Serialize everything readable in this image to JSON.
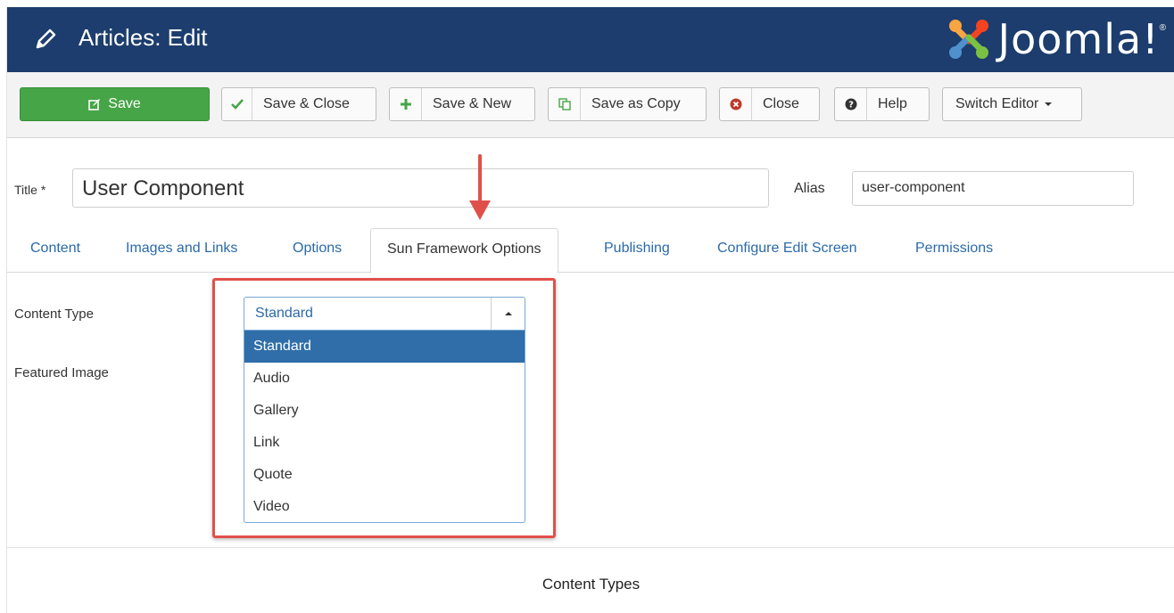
{
  "header": {
    "title": "Articles: Edit",
    "logo_text": "Joomla!",
    "logo_reg": "®",
    "bg_color": "#1c3d6d"
  },
  "toolbar": {
    "save_label": "Save",
    "save_close_label": "Save & Close",
    "save_new_label": "Save & New",
    "save_copy_label": "Save as Copy",
    "close_label": "Close",
    "help_label": "Help",
    "switch_editor_label": "Switch Editor",
    "save_color": "#46a546"
  },
  "form": {
    "title_label": "Title *",
    "title_value": "User Component",
    "alias_label": "Alias",
    "alias_value": "user-component"
  },
  "tabs": [
    {
      "label": "Content"
    },
    {
      "label": "Images and Links"
    },
    {
      "label": "Options"
    },
    {
      "label": "Sun Framework Options"
    },
    {
      "label": "Publishing"
    },
    {
      "label": "Configure Edit Screen"
    },
    {
      "label": "Permissions"
    }
  ],
  "fields": {
    "content_type_label": "Content Type",
    "featured_image_label": "Featured Image",
    "content_type_value": "Standard",
    "options": [
      "Standard",
      "Audio",
      "Gallery",
      "Link",
      "Quote",
      "Video"
    ]
  },
  "caption": "Content Types",
  "colors": {
    "highlight": "#e0504a",
    "tab_link": "#2a6aa9",
    "selected_option": "#2f6ea8"
  }
}
